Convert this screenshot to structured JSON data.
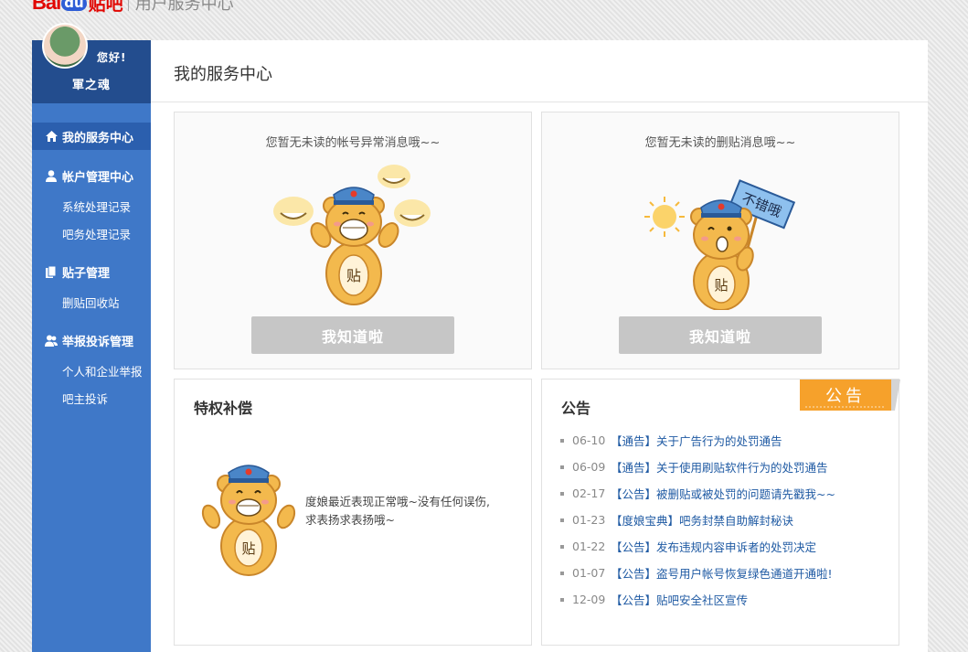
{
  "header": {
    "logo_bai": "Bai",
    "logo_du": "du",
    "logo_tieba": "贴吧",
    "subtitle": "用户服务中心"
  },
  "user": {
    "greeting": "您好!",
    "name": "軍之魂"
  },
  "sidebar": {
    "active": {
      "label": "我的服务中心",
      "icon": "home-icon"
    },
    "sections": [
      {
        "label": "帐户管理中心",
        "icon": "user-icon",
        "items": [
          "系统处理记录",
          "吧务处理记录"
        ]
      },
      {
        "label": "贴子管理",
        "icon": "documents-icon",
        "items": [
          "删贴回收站"
        ]
      },
      {
        "label": "举报投诉管理",
        "icon": "users-icon",
        "items": [
          "个人和企业举报",
          "吧主投诉"
        ]
      }
    ]
  },
  "main": {
    "title": "我的服务中心",
    "account_card": {
      "message": "您暂无未读的帐号异常消息哦~~",
      "button": "我知道啦"
    },
    "delete_card": {
      "message": "您暂无未读的删贴消息哦~~",
      "button": "我知道啦",
      "sign_text": "不错哦"
    },
    "privilege": {
      "title": "特权补偿",
      "text_line1": "度娘最近表现正常哦~没有任何误伤,",
      "text_line2": "求表扬求表扬哦~"
    },
    "notice": {
      "title": "公告",
      "tag": "公告",
      "items": [
        {
          "date": "06-10",
          "category": "【通告】",
          "text": "关于广告行为的处罚通告"
        },
        {
          "date": "06-09",
          "category": "【通告】",
          "text": "关于使用刷贴软件行为的处罚通告"
        },
        {
          "date": "02-17",
          "category": "【公告】",
          "text": "被删贴或被处罚的问题请先戳我~~"
        },
        {
          "date": "01-23",
          "category": "【度娘宝典】",
          "text": "吧务封禁自助解封秘诀"
        },
        {
          "date": "01-22",
          "category": "【公告】",
          "text": "发布违规内容申诉者的处罚决定"
        },
        {
          "date": "01-07",
          "category": "【公告】",
          "text": "盗号用户帐号恢复绿色通道开通啦!"
        },
        {
          "date": "12-09",
          "category": "【公告】",
          "text": "贴吧安全社区宣传"
        }
      ]
    }
  },
  "bear_glyph": "贴",
  "colors": {
    "brand_red": "#e10601",
    "sidebar": "#3f78c8",
    "sidebar_dark": "#234d8e",
    "link": "#1f5aa3",
    "tag_orange": "#f6a12b",
    "button_gray": "#c6c6c6"
  }
}
